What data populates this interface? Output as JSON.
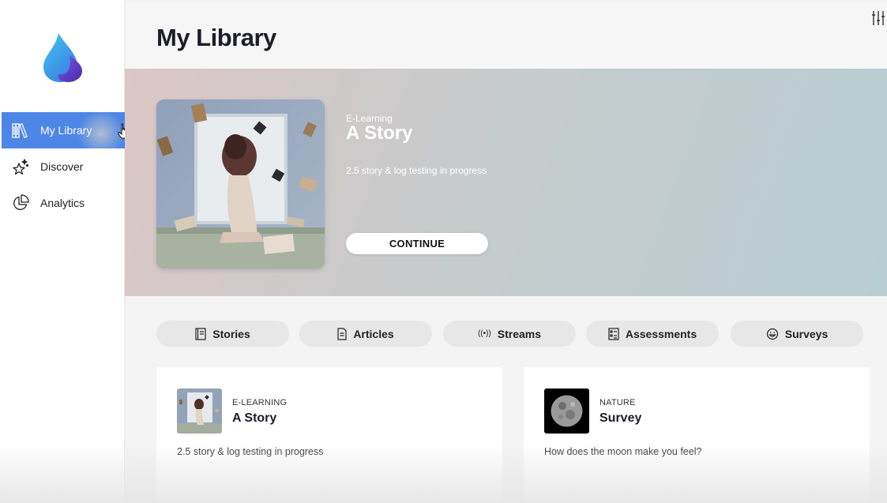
{
  "sidebar": {
    "items": [
      {
        "label": "My Library",
        "icon": "library-icon",
        "active": true
      },
      {
        "label": "Discover",
        "icon": "sparkle-star-icon",
        "active": false
      },
      {
        "label": "Analytics",
        "icon": "pie-chart-icon",
        "active": false
      }
    ]
  },
  "header": {
    "title": "My Library",
    "filter_icon": "sliders-icon"
  },
  "hero": {
    "category": "E-Learning",
    "title": "A Story",
    "description": "2.5 story & log testing in progress",
    "button_label": "CONTINUE"
  },
  "tabs": [
    {
      "label": "Stories",
      "icon": "book-icon"
    },
    {
      "label": "Articles",
      "icon": "document-icon"
    },
    {
      "label": "Streams",
      "icon": "broadcast-icon",
      "prefix": "((•))"
    },
    {
      "label": "Assessments",
      "icon": "checklist-icon"
    },
    {
      "label": "Surveys",
      "icon": "smiley-icon"
    }
  ],
  "cards": [
    {
      "category": "E-LEARNING",
      "title": "A Story",
      "description": "2.5 story & log testing in progress"
    },
    {
      "category": "NATURE",
      "title": "Survey",
      "description": "How does the moon make you feel?"
    }
  ],
  "colors": {
    "accent": "#4d86e6",
    "title_text": "#1d1d2b",
    "tab_bg": "#e7e7e7"
  }
}
